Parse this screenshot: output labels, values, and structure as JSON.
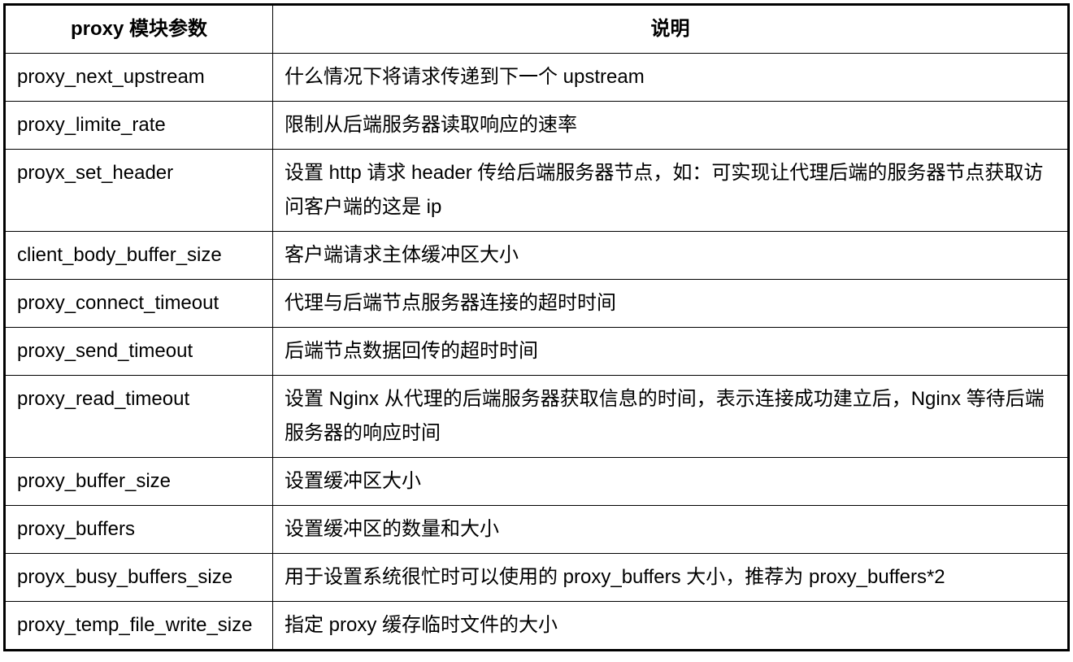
{
  "table": {
    "headers": {
      "param": "proxy 模块参数",
      "desc": "说明"
    },
    "rows": [
      {
        "param": "proxy_next_upstream",
        "desc": "什么情况下将请求传递到下一个 upstream"
      },
      {
        "param": "proxy_limite_rate",
        "desc": "限制从后端服务器读取响应的速率"
      },
      {
        "param": "proyx_set_header",
        "desc": "设置 http 请求 header 传给后端服务器节点，如：可实现让代理后端的服务器节点获取访问客户端的这是 ip"
      },
      {
        "param": "client_body_buffer_size",
        "desc": "客户端请求主体缓冲区大小"
      },
      {
        "param": "proxy_connect_timeout",
        "desc": "代理与后端节点服务器连接的超时时间"
      },
      {
        "param": "proxy_send_timeout",
        "desc": "后端节点数据回传的超时时间"
      },
      {
        "param": "proxy_read_timeout",
        "desc": "设置 Nginx 从代理的后端服务器获取信息的时间，表示连接成功建立后，Nginx 等待后端服务器的响应时间"
      },
      {
        "param": "proxy_buffer_size",
        "desc": "设置缓冲区大小"
      },
      {
        "param": "proxy_buffers",
        "desc": "设置缓冲区的数量和大小"
      },
      {
        "param": "proyx_busy_buffers_size",
        "desc": "用于设置系统很忙时可以使用的 proxy_buffers 大小，推荐为 proxy_buffers*2"
      },
      {
        "param": "proxy_temp_file_write_size",
        "desc": "指定 proxy 缓存临时文件的大小"
      }
    ]
  }
}
